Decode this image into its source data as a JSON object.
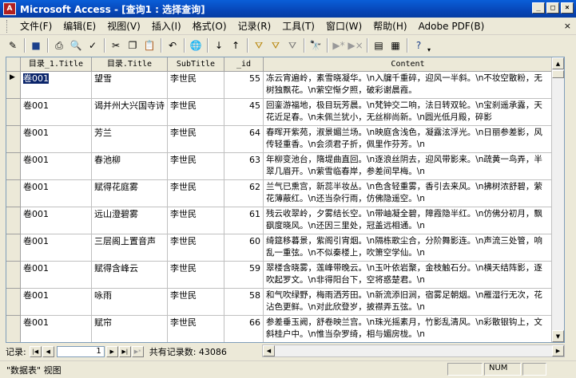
{
  "window": {
    "title": "Microsoft Access - [查询1 : 选择查询]",
    "icon_label": "A"
  },
  "menu": {
    "items": [
      "文件(F)",
      "编辑(E)",
      "视图(V)",
      "插入(I)",
      "格式(O)",
      "记录(R)",
      "工具(T)",
      "窗口(W)",
      "帮助(H)",
      "Adobe PDF(B)"
    ],
    "close_doc": "×"
  },
  "grid": {
    "columns": [
      "目录_1.Title",
      "目录.Title",
      "SubTitle",
      "_id",
      "Content"
    ],
    "rows": [
      {
        "c1": "卷001",
        "c2": "望雪",
        "c3": "李世民",
        "id": "55",
        "content": "冻云宵遍岭，素雪晓凝华。\\n入牖千重碎，迎风一半斜。\\n不妆空散粉，无树独飘花。\\n萦空惭夕照，破彩谢晨霞。"
      },
      {
        "c1": "卷001",
        "c2": "谒并州大兴国寺诗",
        "c3": "李世民",
        "id": "45",
        "content": "回銮游福地，极目玩芳晨。\\n梵钟交二响，法日转双轮。\\n宝刹遥承露，天花近足春。\\n未佩兰犹小，无丝柳尚新。\\n圆光低月殿，碎影"
      },
      {
        "c1": "卷001",
        "c2": "芳兰",
        "c3": "李世民",
        "id": "64",
        "content": "春晖开紫苑，淑景媚兰场。\\n映庭含浅色，凝露泫浮光。\\n日丽参差影，风传轻重香。\\n会须君子折，佩里作芬芳。\\n"
      },
      {
        "c1": "卷001",
        "c2": "春池柳",
        "c3": "李世民",
        "id": "63",
        "content": "年柳变池台，隋堤曲直回。\\n逐浪丝阴去，迎风带影来。\\n疏黄一鸟弄，半翠几眉开。\\n萦雪临春岸，参差间早梅。\\n"
      },
      {
        "c1": "卷001",
        "c2": "赋得花庭雾",
        "c3": "李世民",
        "id": "62",
        "content": "兰气已熏宫，新蕊半妆丛。\\n色含轻重雾，香引去来风。\\n拂树浓舒碧，萦花薄蔽红。\\n还当杂行雨，仿佛隐遥空。\\n"
      },
      {
        "c1": "卷001",
        "c2": "远山澄碧雾",
        "c3": "李世民",
        "id": "61",
        "content": "残云收翠岭，夕雾结长空。\\n带岫凝全碧，障霞隐半红。\\n仿佛分初月，飘飖度晓风。\\n还因三里处，冠盖远相通。\\n"
      },
      {
        "c1": "卷001",
        "c2": "三层阁上置音声",
        "c3": "李世民",
        "id": "60",
        "content": "绮筵移暮景，紫阁引宵烟。\\n隔栋歌尘合，分阶舞影连。\\n声流三处管，响乱一重弦。\\n不似秦楼上，吹箫空学仙。\\n"
      },
      {
        "c1": "卷001",
        "c2": "赋得含峰云",
        "c3": "李世民",
        "id": "59",
        "content": "翠楼含晓雾，莲峰带晚云。\\n玉叶依岩聚，金枝触石分。\\n横天结阵影，逐吹起罗文。\\n非得阳台下，空将惑楚君。\\n"
      },
      {
        "c1": "卷001",
        "c2": "咏雨",
        "c3": "李世民",
        "id": "58",
        "content": "和气吹绿野，梅雨洒芳田。\\n新流添旧涧，宿雾足朝烟。\\n雁湿行无次，花沾色更鲜。\\n对此欣登岁，披襟弄五弦。\\n"
      },
      {
        "c1": "卷001",
        "c2": "赋帘",
        "c3": "李世民",
        "id": "66",
        "content": "参差垂玉阙，舒卷映兰宫。\\n珠光摇素月，竹影乱清风。\\n彩散银钩上，文斜桂户中。\\n惟当杂罗绮，相与媚房栊。\\n"
      }
    ]
  },
  "nav": {
    "label": "记录:",
    "current": "1",
    "total_text": "共有记录数: 43086"
  },
  "status": {
    "left": "\"数据表\" 视图",
    "num": "NUM"
  }
}
